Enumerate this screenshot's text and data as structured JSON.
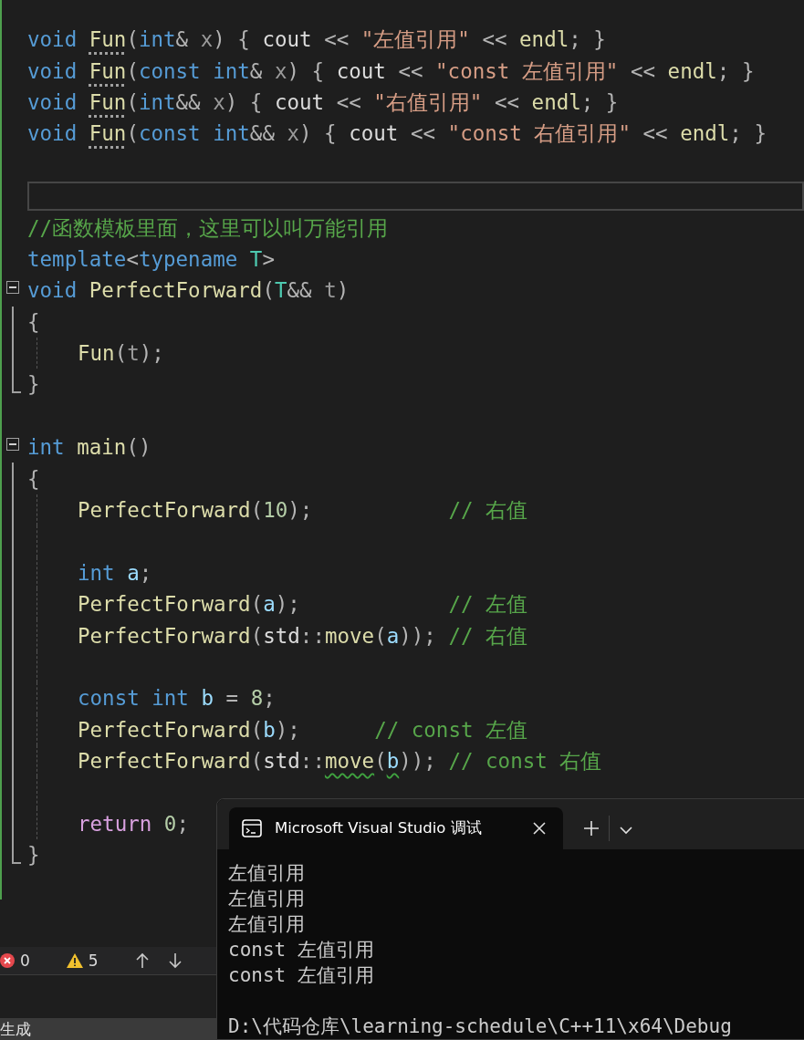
{
  "editor": {
    "lines": [
      {
        "kind": "code",
        "tokens": [
          {
            "kind": "keyword",
            "text": "void "
          },
          {
            "kind": "func",
            "text": "Fun",
            "hint": true
          },
          {
            "kind": "punct",
            "text": "("
          },
          {
            "kind": "keyword",
            "text": "int"
          },
          {
            "kind": "punct",
            "text": "& "
          },
          {
            "kind": "param",
            "text": "x"
          },
          {
            "kind": "punct",
            "text": ") { "
          },
          {
            "kind": "plain",
            "text": "cout "
          },
          {
            "kind": "punct",
            "text": "<< "
          },
          {
            "kind": "string",
            "text": "\"左值引用\""
          },
          {
            "kind": "punct",
            "text": " << "
          },
          {
            "kind": "func",
            "text": "endl"
          },
          {
            "kind": "punct",
            "text": "; }"
          }
        ]
      },
      {
        "kind": "code",
        "tokens": [
          {
            "kind": "keyword",
            "text": "void "
          },
          {
            "kind": "func",
            "text": "Fun",
            "hint": true
          },
          {
            "kind": "punct",
            "text": "("
          },
          {
            "kind": "keyword",
            "text": "const int"
          },
          {
            "kind": "punct",
            "text": "& "
          },
          {
            "kind": "param",
            "text": "x"
          },
          {
            "kind": "punct",
            "text": ") { "
          },
          {
            "kind": "plain",
            "text": "cout "
          },
          {
            "kind": "punct",
            "text": "<< "
          },
          {
            "kind": "string",
            "text": "\"const 左值引用\""
          },
          {
            "kind": "punct",
            "text": " << "
          },
          {
            "kind": "func",
            "text": "endl"
          },
          {
            "kind": "punct",
            "text": "; }"
          }
        ]
      },
      {
        "kind": "code",
        "tokens": [
          {
            "kind": "keyword",
            "text": "void "
          },
          {
            "kind": "func",
            "text": "Fun",
            "hint": true
          },
          {
            "kind": "punct",
            "text": "("
          },
          {
            "kind": "keyword",
            "text": "int"
          },
          {
            "kind": "punct",
            "text": "&& "
          },
          {
            "kind": "param",
            "text": "x"
          },
          {
            "kind": "punct",
            "text": ") { "
          },
          {
            "kind": "plain",
            "text": "cout "
          },
          {
            "kind": "punct",
            "text": "<< "
          },
          {
            "kind": "string",
            "text": "\"右值引用\""
          },
          {
            "kind": "punct",
            "text": " << "
          },
          {
            "kind": "func",
            "text": "endl"
          },
          {
            "kind": "punct",
            "text": "; }"
          }
        ]
      },
      {
        "kind": "code",
        "tokens": [
          {
            "kind": "keyword",
            "text": "void "
          },
          {
            "kind": "func",
            "text": "Fun",
            "hint": true
          },
          {
            "kind": "punct",
            "text": "("
          },
          {
            "kind": "keyword",
            "text": "const int"
          },
          {
            "kind": "punct",
            "text": "&& "
          },
          {
            "kind": "param",
            "text": "x"
          },
          {
            "kind": "punct",
            "text": ") { "
          },
          {
            "kind": "plain",
            "text": "cout "
          },
          {
            "kind": "punct",
            "text": "<< "
          },
          {
            "kind": "string",
            "text": "\"const 右值引用\""
          },
          {
            "kind": "punct",
            "text": " << "
          },
          {
            "kind": "func",
            "text": "endl"
          },
          {
            "kind": "punct",
            "text": "; }"
          }
        ]
      },
      {
        "kind": "blank"
      },
      {
        "kind": "current"
      },
      {
        "kind": "code",
        "tokens": [
          {
            "kind": "comment",
            "text": "//函数模板里面，这里可以叫万能引用"
          }
        ]
      },
      {
        "kind": "code",
        "tokens": [
          {
            "kind": "keyword",
            "text": "template"
          },
          {
            "kind": "punct",
            "text": "<"
          },
          {
            "kind": "keyword",
            "text": "typename "
          },
          {
            "kind": "type",
            "text": "T"
          },
          {
            "kind": "punct",
            "text": ">"
          }
        ]
      },
      {
        "kind": "code",
        "fold_start": true,
        "tokens": [
          {
            "kind": "keyword",
            "text": "void "
          },
          {
            "kind": "func",
            "text": "PerfectForward"
          },
          {
            "kind": "punct",
            "text": "("
          },
          {
            "kind": "type",
            "text": "T"
          },
          {
            "kind": "punct",
            "text": "&& "
          },
          {
            "kind": "param",
            "text": "t"
          },
          {
            "kind": "punct",
            "text": ")"
          }
        ]
      },
      {
        "kind": "code",
        "fold_guide": true,
        "tokens": [
          {
            "kind": "punct",
            "text": "{"
          }
        ]
      },
      {
        "kind": "code",
        "fold_guide": true,
        "indent": true,
        "tokens": [
          {
            "kind": "func",
            "text": "Fun"
          },
          {
            "kind": "punct",
            "text": "("
          },
          {
            "kind": "param",
            "text": "t"
          },
          {
            "kind": "punct",
            "text": ");"
          }
        ]
      },
      {
        "kind": "code",
        "fold_end": true,
        "tokens": [
          {
            "kind": "punct",
            "text": "}"
          }
        ]
      },
      {
        "kind": "blank"
      },
      {
        "kind": "code",
        "fold_start": true,
        "tokens": [
          {
            "kind": "keyword",
            "text": "int "
          },
          {
            "kind": "func",
            "text": "main"
          },
          {
            "kind": "punct",
            "text": "()"
          }
        ]
      },
      {
        "kind": "code",
        "fold_guide": true,
        "tokens": [
          {
            "kind": "punct",
            "text": "{"
          }
        ]
      },
      {
        "kind": "code",
        "fold_guide": true,
        "indent": true,
        "tokens": [
          {
            "kind": "func",
            "text": "PerfectForward"
          },
          {
            "kind": "punct",
            "text": "("
          },
          {
            "kind": "number",
            "text": "10"
          },
          {
            "kind": "punct",
            "text": ");           "
          },
          {
            "kind": "comment",
            "text": "// 右值"
          }
        ]
      },
      {
        "kind": "blank",
        "fold_guide": true
      },
      {
        "kind": "code",
        "fold_guide": true,
        "indent": true,
        "tokens": [
          {
            "kind": "keyword",
            "text": "int "
          },
          {
            "kind": "local",
            "text": "a"
          },
          {
            "kind": "punct",
            "text": ";"
          }
        ]
      },
      {
        "kind": "code",
        "fold_guide": true,
        "indent": true,
        "tokens": [
          {
            "kind": "func",
            "text": "PerfectForward"
          },
          {
            "kind": "punct",
            "text": "("
          },
          {
            "kind": "local",
            "text": "a"
          },
          {
            "kind": "punct",
            "text": ");            "
          },
          {
            "kind": "comment",
            "text": "// 左值"
          }
        ]
      },
      {
        "kind": "code",
        "fold_guide": true,
        "indent": true,
        "tokens": [
          {
            "kind": "func",
            "text": "PerfectForward"
          },
          {
            "kind": "punct",
            "text": "("
          },
          {
            "kind": "plain",
            "text": "std"
          },
          {
            "kind": "punct",
            "text": "::"
          },
          {
            "kind": "func",
            "text": "move"
          },
          {
            "kind": "punct",
            "text": "("
          },
          {
            "kind": "local",
            "text": "a"
          },
          {
            "kind": "punct",
            "text": ")); "
          },
          {
            "kind": "comment",
            "text": "// 右值"
          }
        ]
      },
      {
        "kind": "blank",
        "fold_guide": true
      },
      {
        "kind": "code",
        "fold_guide": true,
        "indent": true,
        "tokens": [
          {
            "kind": "keyword",
            "text": "const int "
          },
          {
            "kind": "local",
            "text": "b"
          },
          {
            "kind": "punct",
            "text": " = "
          },
          {
            "kind": "number",
            "text": "8"
          },
          {
            "kind": "punct",
            "text": ";"
          }
        ]
      },
      {
        "kind": "code",
        "fold_guide": true,
        "indent": true,
        "tokens": [
          {
            "kind": "func",
            "text": "PerfectForward"
          },
          {
            "kind": "punct",
            "text": "("
          },
          {
            "kind": "local",
            "text": "b"
          },
          {
            "kind": "punct",
            "text": ");      "
          },
          {
            "kind": "comment",
            "text": "// const 左值"
          }
        ]
      },
      {
        "kind": "code",
        "fold_guide": true,
        "indent": true,
        "tokens": [
          {
            "kind": "func",
            "text": "PerfectForward"
          },
          {
            "kind": "punct",
            "text": "("
          },
          {
            "kind": "plain",
            "text": "std"
          },
          {
            "kind": "punct",
            "text": "::"
          },
          {
            "kind": "func",
            "text": "move",
            "squiggle": true
          },
          {
            "kind": "punct",
            "text": "("
          },
          {
            "kind": "local",
            "text": "b",
            "squiggle": true
          },
          {
            "kind": "punct",
            "text": ")); "
          },
          {
            "kind": "comment",
            "text": "// const 右值"
          }
        ]
      },
      {
        "kind": "blank",
        "fold_guide": true
      },
      {
        "kind": "code",
        "fold_guide": true,
        "indent": true,
        "tokens": [
          {
            "kind": "control",
            "text": "return "
          },
          {
            "kind": "number",
            "text": "0"
          },
          {
            "kind": "punct",
            "text": ";"
          }
        ]
      },
      {
        "kind": "code",
        "fold_end": true,
        "tokens": [
          {
            "kind": "punct",
            "text": "}"
          }
        ]
      }
    ]
  },
  "error_bar": {
    "errors": "0",
    "warnings": "5"
  },
  "status_bar": {
    "text": "生成"
  },
  "terminal": {
    "tab_title": "Microsoft Visual Studio 调试",
    "output": [
      "左值引用",
      "左值引用",
      "左值引用",
      "const 左值引用",
      "const 左值引用"
    ],
    "path": "D:\\代码仓库\\learning-schedule\\C++11\\x64\\Debug"
  }
}
